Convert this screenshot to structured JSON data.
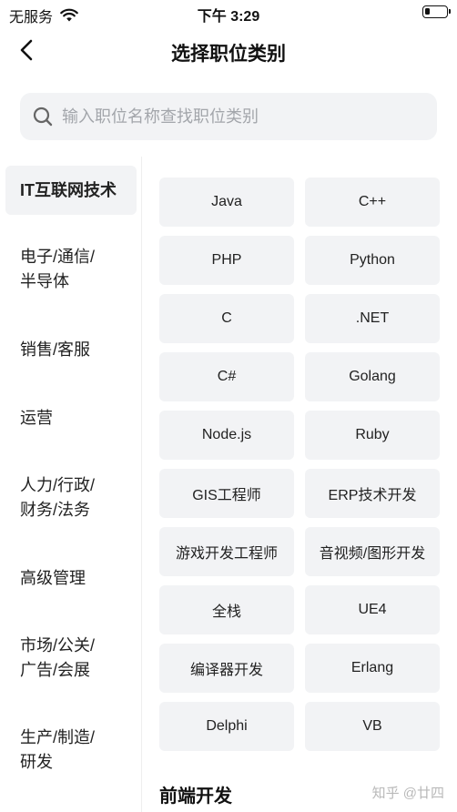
{
  "status_bar": {
    "carrier": "无服务",
    "time": "下午 3:29",
    "battery_level": 0.25
  },
  "header": {
    "title": "选择职位类别",
    "back_icon": "chevron-left-icon"
  },
  "search": {
    "placeholder": "输入职位名称查找职位类别",
    "icon": "search-icon"
  },
  "sidebar": {
    "items": [
      {
        "label": "IT互联网技术",
        "selected": true
      },
      {
        "label": "电子/通信/\n半导体",
        "selected": false
      },
      {
        "label": "销售/客服",
        "selected": false
      },
      {
        "label": "运营",
        "selected": false
      },
      {
        "label": "人力/行政/\n财务/法务",
        "selected": false
      },
      {
        "label": "高级管理",
        "selected": false
      },
      {
        "label": "市场/公关/\n广告/会展",
        "selected": false
      },
      {
        "label": "生产/制造/\n研发",
        "selected": false
      }
    ]
  },
  "categories": [
    "Java",
    "C++",
    "PHP",
    "Python",
    "C",
    ".NET",
    "C#",
    "Golang",
    "Node.js",
    "Ruby",
    "GIS工程师",
    "ERP技术开发",
    "游戏开发工程师",
    "音视频/图形开发",
    "全栈",
    "UE4",
    "编译器开发",
    "Erlang",
    "Delphi",
    "VB"
  ],
  "next_section": "前端开发",
  "watermark": "知乎 @廿四",
  "colors": {
    "chip_background": "#f2f3f5",
    "text": "#222222",
    "placeholder": "#a3a6ab"
  }
}
